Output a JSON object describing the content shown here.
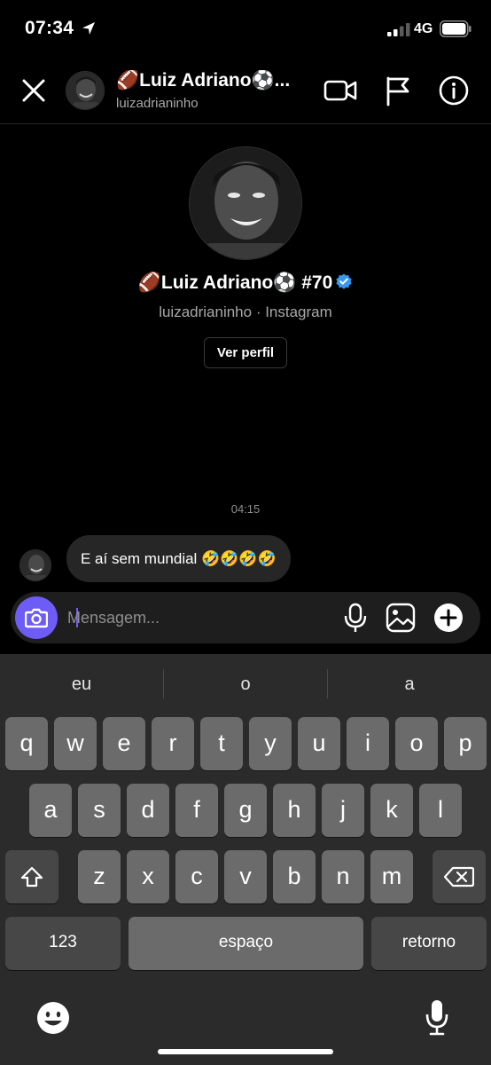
{
  "status_bar": {
    "time": "07:34",
    "network": "4G"
  },
  "header": {
    "name": "🏈Luiz Adriano⚽...",
    "username": "luizadrianinho"
  },
  "profile": {
    "name": "🏈Luiz Adriano⚽ #70",
    "subtitle": "luizadrianinho · Instagram",
    "view_profile_label": "Ver perfil"
  },
  "conversation": {
    "timestamp": "04:15",
    "messages": [
      {
        "text": "E aí sem mundial 🤣🤣🤣🤣"
      }
    ]
  },
  "composer": {
    "placeholder": "Mensagem...",
    "value": ""
  },
  "keyboard": {
    "suggestions": [
      "eu",
      "o",
      "a"
    ],
    "row1": [
      "q",
      "w",
      "e",
      "r",
      "t",
      "y",
      "u",
      "i",
      "o",
      "p"
    ],
    "row2": [
      "a",
      "s",
      "d",
      "f",
      "g",
      "h",
      "j",
      "k",
      "l"
    ],
    "row3": [
      "z",
      "x",
      "c",
      "v",
      "b",
      "n",
      "m"
    ],
    "numbers_label": "123",
    "space_label": "espaço",
    "return_label": "retorno"
  },
  "colors": {
    "accent": "#6d5cf5",
    "verified": "#3897f0",
    "bubble": "#262626",
    "keyboard_bg": "#2b2b2b"
  },
  "icons": [
    "location-arrow-icon",
    "signal-icon",
    "battery-icon",
    "close-icon",
    "video-call-icon",
    "flag-icon",
    "info-icon",
    "verified-badge-icon",
    "camera-icon",
    "microphone-icon",
    "gallery-icon",
    "plus-icon",
    "shift-icon",
    "backspace-icon",
    "emoji-icon",
    "dictation-icon"
  ]
}
